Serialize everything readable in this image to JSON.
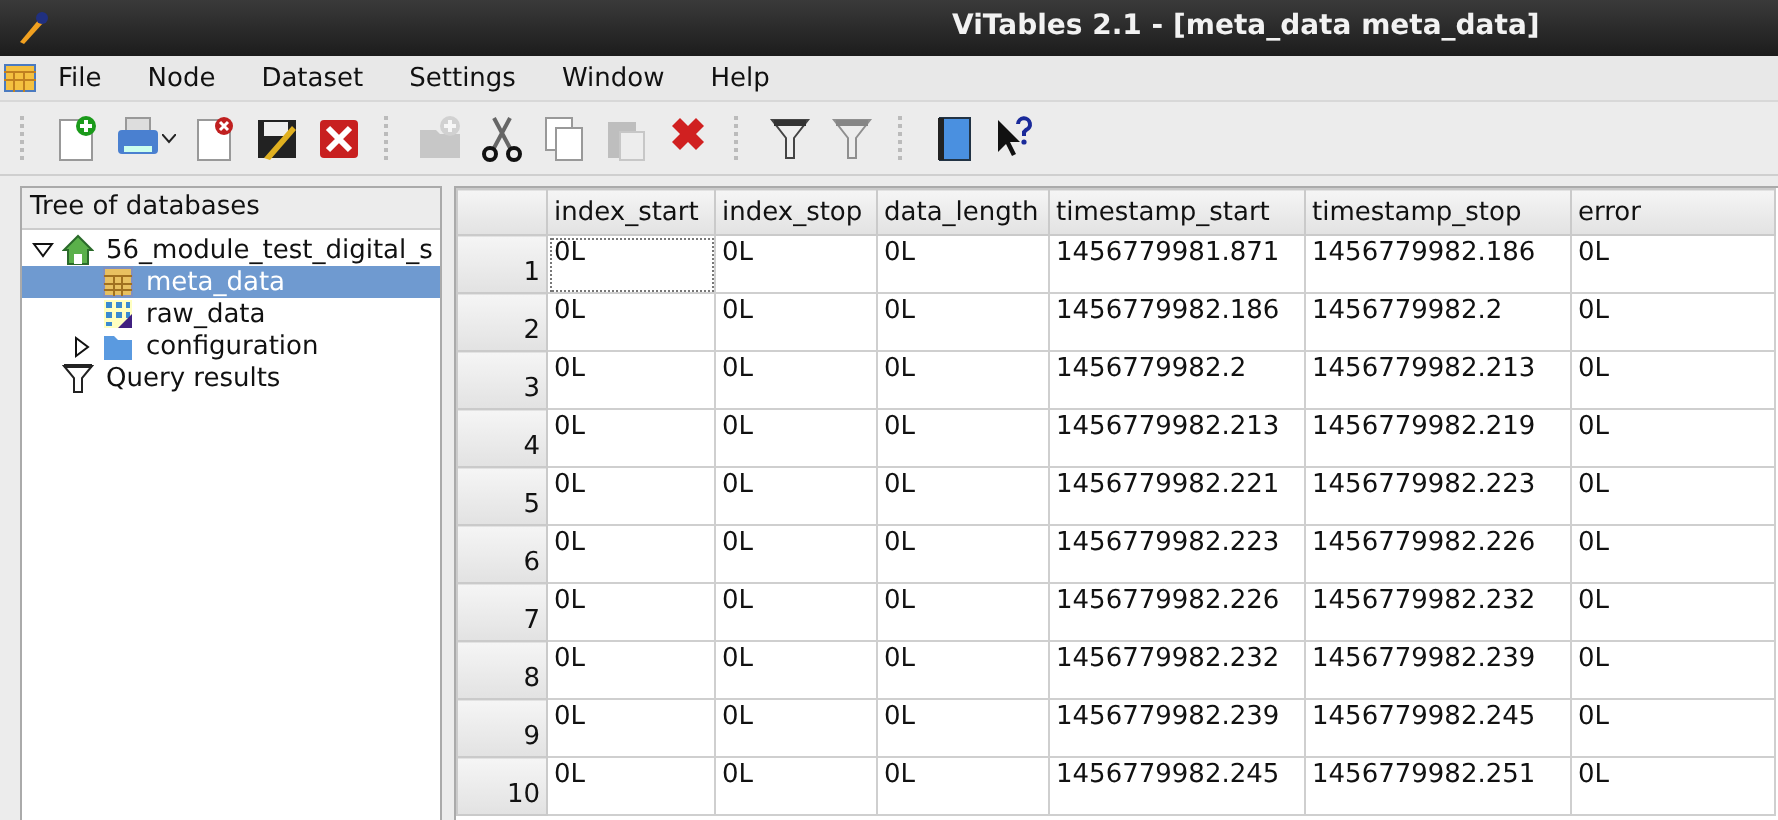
{
  "window": {
    "title": "ViTables 2.1 - [meta_data  meta_data]"
  },
  "menu": [
    "File",
    "Node",
    "Dataset",
    "Settings",
    "Window",
    "Help"
  ],
  "toolbar": [
    [
      {
        "kind": "new",
        "disabled": false
      },
      {
        "kind": "print",
        "disabled": false
      },
      {
        "kind": "close",
        "disabled": false
      },
      {
        "kind": "saveas",
        "disabled": false
      },
      {
        "kind": "closeall",
        "disabled": false
      }
    ],
    [
      {
        "kind": "newgroup",
        "disabled": true
      },
      {
        "kind": "cut",
        "disabled": false
      },
      {
        "kind": "copy",
        "disabled": false
      },
      {
        "kind": "paste",
        "disabled": true
      },
      {
        "kind": "delete",
        "disabled": false
      }
    ],
    [
      {
        "kind": "query",
        "disabled": false
      },
      {
        "kind": "query",
        "disabled": true
      }
    ],
    [
      {
        "kind": "help",
        "disabled": false
      },
      {
        "kind": "whatsthis",
        "disabled": false
      }
    ]
  ],
  "tree": {
    "title": "Tree of databases",
    "items": [
      {
        "label": "56_module_test_digital_s",
        "kind": "file",
        "expanded": true,
        "selected": false,
        "children": [
          {
            "label": "meta_data",
            "kind": "table",
            "selected": true
          },
          {
            "label": "raw_data",
            "kind": "array",
            "selected": false
          },
          {
            "label": "configuration",
            "kind": "group",
            "expanded": false,
            "selected": false
          }
        ]
      },
      {
        "label": "Query results",
        "kind": "query",
        "selected": false
      }
    ]
  },
  "table": {
    "columns": [
      "index_start",
      "index_stop",
      "data_length",
      "timestamp_start",
      "timestamp_stop",
      "error"
    ],
    "rows": [
      {
        "header": "1",
        "cells": [
          "0L",
          "0L",
          "0L",
          "1456779981.871",
          "1456779982.186",
          "0L"
        ]
      },
      {
        "header": "2",
        "cells": [
          "0L",
          "0L",
          "0L",
          "1456779982.186",
          "1456779982.2",
          "0L"
        ]
      },
      {
        "header": "3",
        "cells": [
          "0L",
          "0L",
          "0L",
          "1456779982.2",
          "1456779982.213",
          "0L"
        ]
      },
      {
        "header": "4",
        "cells": [
          "0L",
          "0L",
          "0L",
          "1456779982.213",
          "1456779982.219",
          "0L"
        ]
      },
      {
        "header": "5",
        "cells": [
          "0L",
          "0L",
          "0L",
          "1456779982.221",
          "1456779982.223",
          "0L"
        ]
      },
      {
        "header": "6",
        "cells": [
          "0L",
          "0L",
          "0L",
          "1456779982.223",
          "1456779982.226",
          "0L"
        ]
      },
      {
        "header": "7",
        "cells": [
          "0L",
          "0L",
          "0L",
          "1456779982.226",
          "1456779982.232",
          "0L"
        ]
      },
      {
        "header": "8",
        "cells": [
          "0L",
          "0L",
          "0L",
          "1456779982.232",
          "1456779982.239",
          "0L"
        ]
      },
      {
        "header": "9",
        "cells": [
          "0L",
          "0L",
          "0L",
          "1456779982.239",
          "1456779982.245",
          "0L"
        ]
      },
      {
        "header": "10",
        "cells": [
          "0L",
          "0L",
          "0L",
          "1456779982.245",
          "1456779982.251",
          "0L"
        ]
      }
    ]
  }
}
